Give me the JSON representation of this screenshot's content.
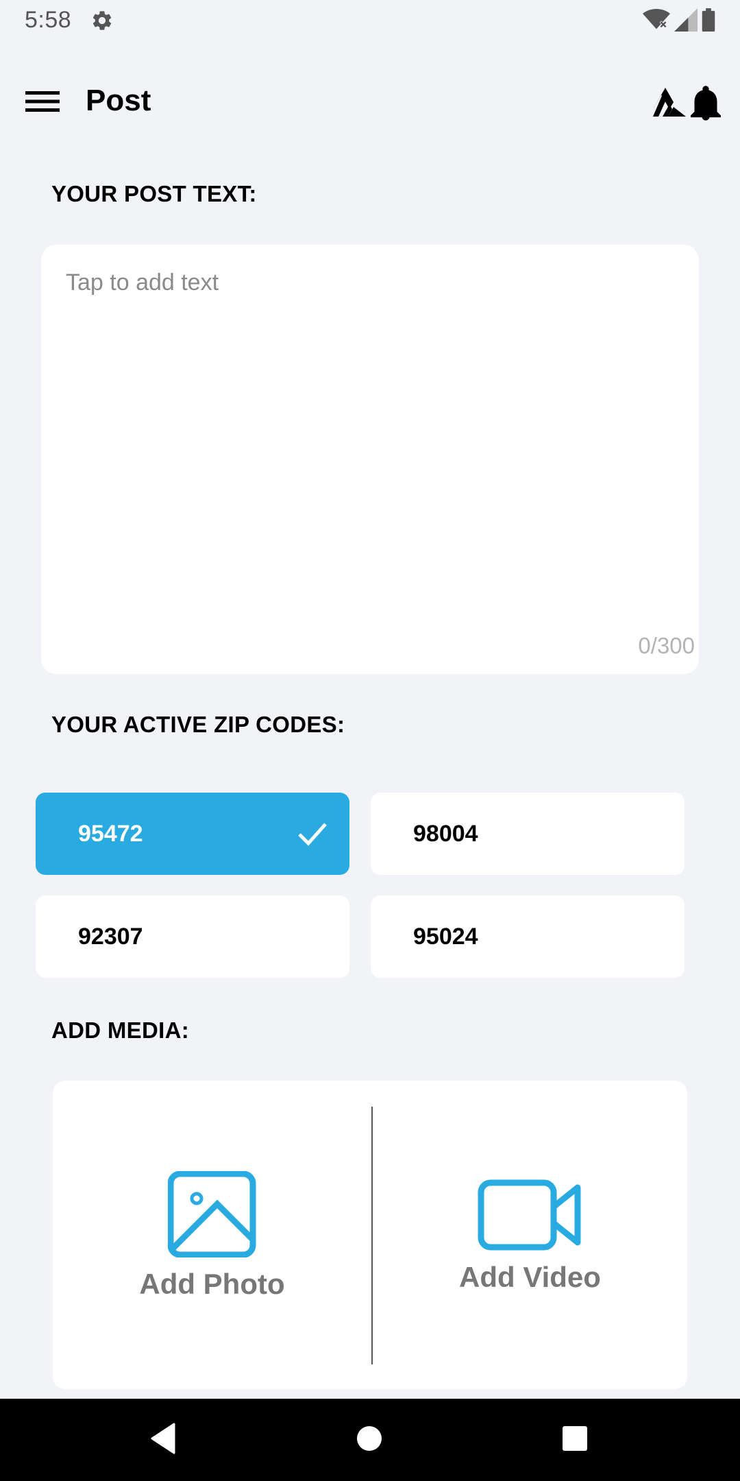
{
  "status_bar": {
    "time": "5:58",
    "icons": [
      "gear-icon",
      "wifi-icon",
      "signal-icon",
      "battery-icon"
    ]
  },
  "app_bar": {
    "title": "Post",
    "icons": [
      "menu-icon",
      "brand-logo-icon",
      "bell-icon"
    ]
  },
  "post_text": {
    "label": "YOUR POST TEXT:",
    "placeholder": "Tap to add text",
    "value": "",
    "char_count": "0/300"
  },
  "zip_codes": {
    "label": "YOUR ACTIVE ZIP CODES:",
    "items": [
      {
        "code": "95472",
        "selected": true
      },
      {
        "code": "98004",
        "selected": false
      },
      {
        "code": "92307",
        "selected": false
      },
      {
        "code": "95024",
        "selected": false
      }
    ]
  },
  "media": {
    "label": "ADD MEDIA:",
    "add_photo_label": "Add Photo",
    "add_video_label": "Add Video"
  },
  "nav_bar": {
    "icons": [
      "back-icon",
      "home-icon",
      "recents-icon"
    ]
  },
  "colors": {
    "accent": "#29ABE2",
    "background": "#F1F3F7",
    "card": "#FFFFFF",
    "muted_text": "#777777",
    "nav_bar": "#000000"
  }
}
